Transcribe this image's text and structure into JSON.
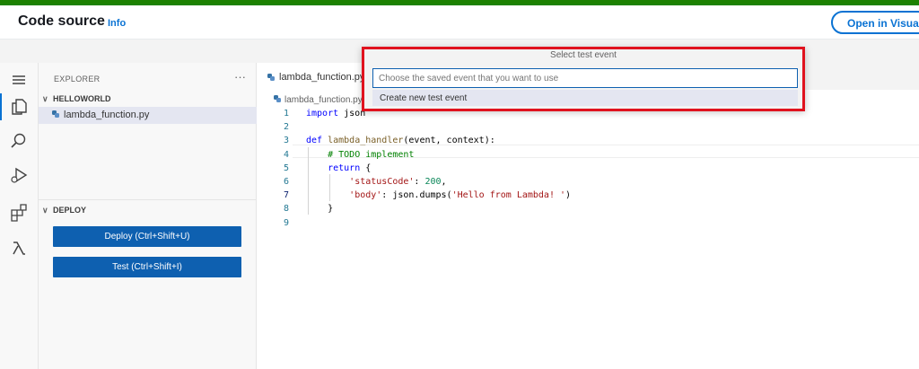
{
  "header": {
    "title": "Code source",
    "info": "Info",
    "open_button": "Open in Visual"
  },
  "explorer": {
    "title": "EXPLORER",
    "more": "···",
    "folder": "HELLOWORLD",
    "file": "lambda_function.py"
  },
  "deploy": {
    "title": "DEPLOY",
    "deploy_button": "Deploy (Ctrl+Shift+U)",
    "test_button": "Test (Ctrl+Shift+I)"
  },
  "editor": {
    "tab": "lambda_function.py",
    "breadcrumb": "lambda_function.py",
    "active_line": 7,
    "lines": [
      {
        "n": "1",
        "tokens": [
          {
            "t": "import",
            "c": "kw"
          },
          {
            "t": " json",
            "c": "plain"
          }
        ]
      },
      {
        "n": "2",
        "tokens": []
      },
      {
        "n": "3",
        "tokens": [
          {
            "t": "def",
            "c": "kw"
          },
          {
            "t": " ",
            "c": "plain"
          },
          {
            "t": "lambda_handler",
            "c": "fn"
          },
          {
            "t": "(event, context):",
            "c": "plain"
          }
        ]
      },
      {
        "n": "4",
        "tokens": [
          {
            "t": "    ",
            "c": "plain"
          },
          {
            "t": "# TODO implement",
            "c": "cm"
          }
        ]
      },
      {
        "n": "5",
        "tokens": [
          {
            "t": "    ",
            "c": "plain"
          },
          {
            "t": "return",
            "c": "kw"
          },
          {
            "t": " {",
            "c": "plain"
          }
        ]
      },
      {
        "n": "6",
        "tokens": [
          {
            "t": "        ",
            "c": "plain"
          },
          {
            "t": "'statusCode'",
            "c": "str"
          },
          {
            "t": ": ",
            "c": "plain"
          },
          {
            "t": "200",
            "c": "num"
          },
          {
            "t": ",",
            "c": "plain"
          }
        ]
      },
      {
        "n": "7",
        "tokens": [
          {
            "t": "        ",
            "c": "plain"
          },
          {
            "t": "'body'",
            "c": "str"
          },
          {
            "t": ": json.dumps(",
            "c": "plain"
          },
          {
            "t": "'Hello from Lambda! '",
            "c": "str"
          },
          {
            "t": ")",
            "c": "plain"
          }
        ]
      },
      {
        "n": "8",
        "tokens": [
          {
            "t": "    }",
            "c": "plain"
          }
        ]
      },
      {
        "n": "9",
        "tokens": []
      }
    ]
  },
  "quick_pick": {
    "title": "Select test event",
    "placeholder": "Choose the saved event that you want to use",
    "item": "Create new test event"
  },
  "colors": {
    "accent": "#0972d3",
    "button": "#0e60b0",
    "highlight": "#e0121e",
    "topbar": "#1d8102"
  }
}
